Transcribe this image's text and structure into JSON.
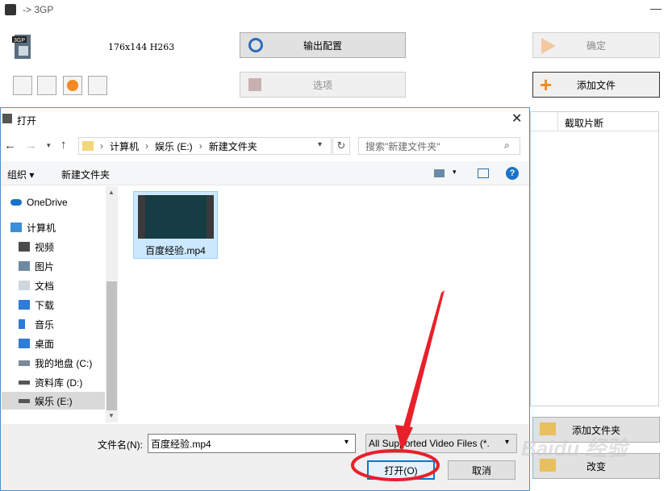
{
  "app": {
    "title": "-> 3GP",
    "format_info": "176x144 H263",
    "buttons": {
      "output_config": "输出配置",
      "options": "选项",
      "confirm": "确定",
      "add_file": "添加文件",
      "add_folder": "添加文件夹",
      "change": "改变"
    },
    "table_header_clip": "截取片断"
  },
  "dialog": {
    "title": "打开",
    "breadcrumb": [
      "计算机",
      "娱乐 (E:)",
      "新建文件夹"
    ],
    "search_placeholder": "搜索\"新建文件夹\"",
    "toolbar": {
      "organize": "组织 ▾",
      "new_folder": "新建文件夹"
    },
    "nav_items": [
      {
        "label": "OneDrive",
        "icon": "cloud-icon"
      },
      {
        "label": "计算机",
        "icon": "computer-icon"
      },
      {
        "label": "视频",
        "icon": "video-folder-icon"
      },
      {
        "label": "图片",
        "icon": "pictures-folder-icon"
      },
      {
        "label": "文档",
        "icon": "documents-folder-icon"
      },
      {
        "label": "下载",
        "icon": "downloads-icon"
      },
      {
        "label": "音乐",
        "icon": "music-icon"
      },
      {
        "label": "桌面",
        "icon": "desktop-icon"
      },
      {
        "label": "我的地盘 (C:)",
        "icon": "drive-icon"
      },
      {
        "label": "资料库 (D:)",
        "icon": "drive-icon"
      },
      {
        "label": "娱乐 (E:)",
        "icon": "drive-icon"
      }
    ],
    "file": {
      "name": "百度经验.mp4"
    },
    "filename_label": "文件名(N):",
    "filename_value": "百度经验.mp4",
    "filetype_value": "All Supported Video Files (*.",
    "open_button": "打开(O)",
    "cancel_button": "取消"
  },
  "watermark": "Baidu 经验",
  "colors": {
    "accent": "#0078d7",
    "annotation": "#e8202a",
    "selection": "#cce8ff"
  }
}
